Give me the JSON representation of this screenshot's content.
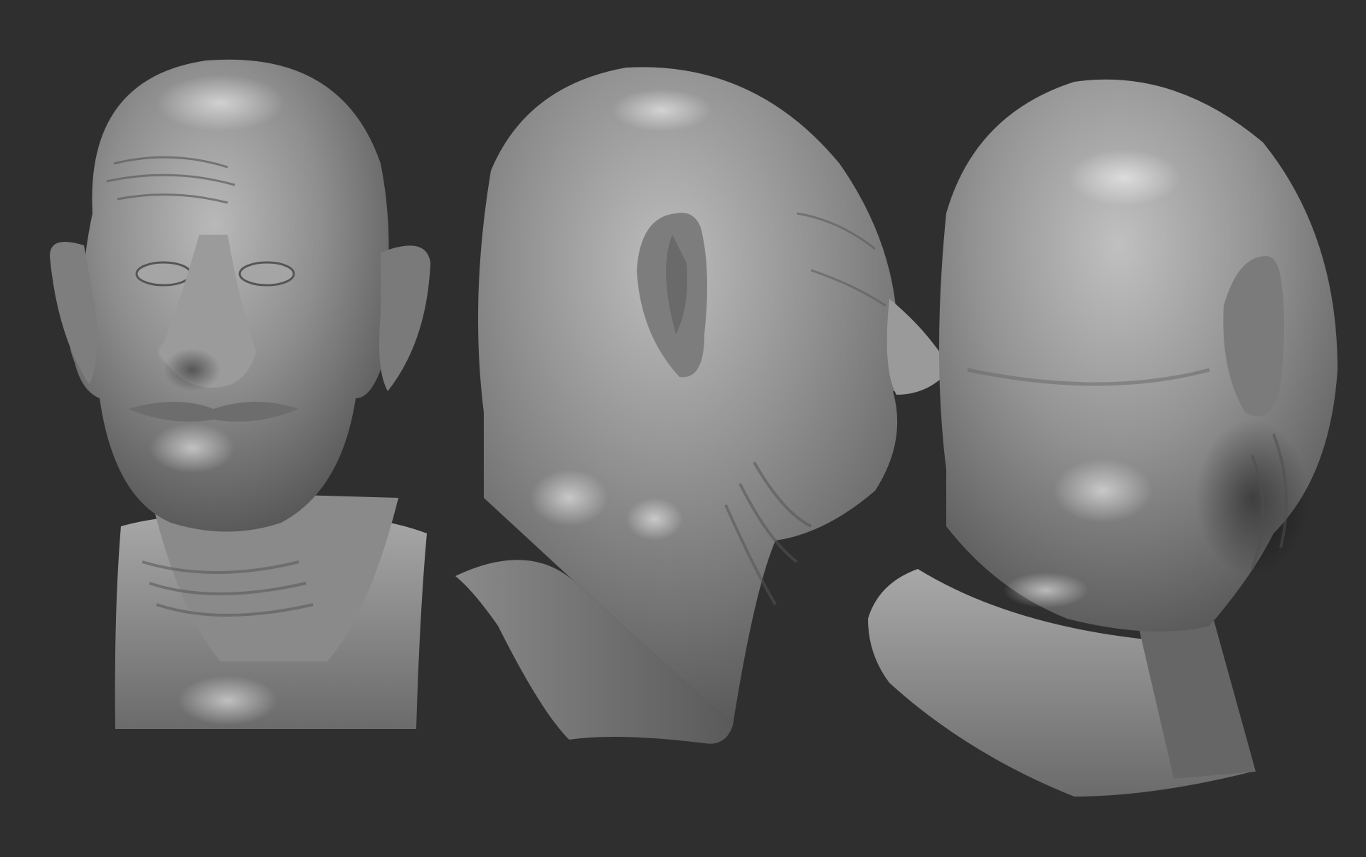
{
  "scene": {
    "background_color": "#2f2f2f",
    "clay_color": "#8c8c8c",
    "views": [
      {
        "view": "front"
      },
      {
        "view": "side"
      },
      {
        "view": "back-three-quarter"
      }
    ]
  }
}
